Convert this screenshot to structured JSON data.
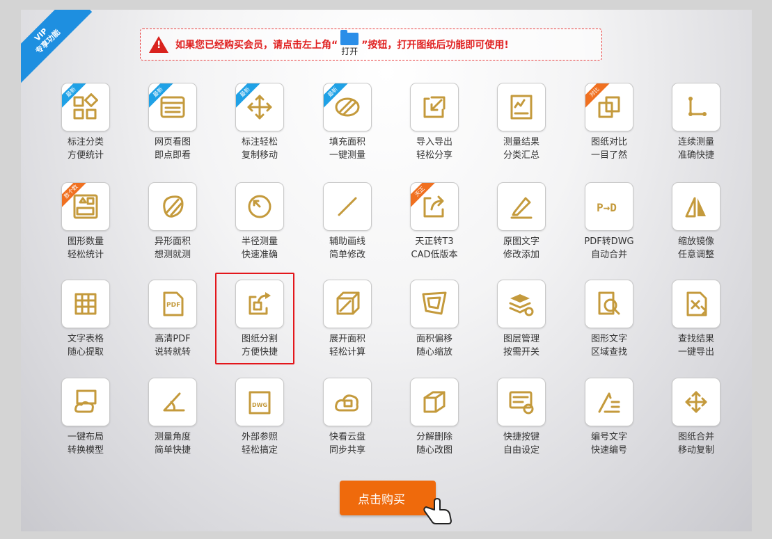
{
  "corner_ribbon": {
    "line1": "VIP",
    "line2": "专享功能"
  },
  "notice": {
    "before": "如果您已经购买会员，请点击左上角“",
    "open_label": "打开",
    "after": "”按钮，打开图纸后功能即可使用!"
  },
  "items": [
    {
      "line1": "标注分类",
      "line2": "方便统计",
      "icon": "grid-shapes-icon",
      "badge": "最新"
    },
    {
      "line1": "网页看图",
      "line2": "即点即看",
      "icon": "browser-window-icon",
      "badge": "最新"
    },
    {
      "line1": "标注轻松",
      "line2": "复制移动",
      "icon": "move-arrows-icon",
      "badge": "最新"
    },
    {
      "line1": "填充面积",
      "line2": "一键测量",
      "icon": "hatch-fill-icon",
      "badge": "最新"
    },
    {
      "line1": "导入导出",
      "line2": "轻松分享",
      "icon": "import-export-icon",
      "badge": ""
    },
    {
      "line1": "测量结果",
      "line2": "分类汇总",
      "icon": "measure-summary-icon",
      "badge": ""
    },
    {
      "line1": "图纸对比",
      "line2": "一目了然",
      "icon": "compare-squares-icon",
      "badge": "对比"
    },
    {
      "line1": "连续测量",
      "line2": "准确快捷",
      "icon": "continuous-measure-icon",
      "badge": ""
    },
    {
      "line1": "图形数量",
      "line2": "轻松统计",
      "icon": "shape-count-icon",
      "badge": "数个数"
    },
    {
      "line1": "异形面积",
      "line2": "想测就测",
      "icon": "irregular-area-icon",
      "badge": ""
    },
    {
      "line1": "半径测量",
      "line2": "快速准确",
      "icon": "radius-icon",
      "badge": ""
    },
    {
      "line1": "辅助画线",
      "line2": "简单修改",
      "icon": "line-icon",
      "badge": ""
    },
    {
      "line1": "天正转T3",
      "line2": "CAD低版本",
      "icon": "export-t3-icon",
      "badge": "天正"
    },
    {
      "line1": "原图文字",
      "line2": "修改添加",
      "icon": "pencil-icon",
      "badge": ""
    },
    {
      "line1": "PDF转DWG",
      "line2": "自动合并",
      "icon": "pdf-to-dwg-icon",
      "badge": ""
    },
    {
      "line1": "缩放镜像",
      "line2": "任意调整",
      "icon": "mirror-icon",
      "badge": ""
    },
    {
      "line1": "文字表格",
      "line2": "随心提取",
      "icon": "text-table-icon",
      "badge": ""
    },
    {
      "line1": "高清PDF",
      "line2": "说转就转",
      "icon": "pdf-export-icon",
      "badge": ""
    },
    {
      "line1": "图纸分割",
      "line2": "方便快捷",
      "icon": "split-drawing-icon",
      "badge": ""
    },
    {
      "line1": "展开面积",
      "line2": "轻松计算",
      "icon": "unfold-area-icon",
      "badge": ""
    },
    {
      "line1": "面积偏移",
      "line2": "随心缩放",
      "icon": "area-offset-icon",
      "badge": ""
    },
    {
      "line1": "图层管理",
      "line2": "按需开关",
      "icon": "layers-icon",
      "badge": ""
    },
    {
      "line1": "图形文字",
      "line2": "区域查找",
      "icon": "find-text-icon",
      "badge": ""
    },
    {
      "line1": "查找结果",
      "line2": "一键导出",
      "icon": "export-results-icon",
      "badge": ""
    },
    {
      "line1": "一键布局",
      "line2": "转换模型",
      "icon": "layout-cloud-icon",
      "badge": ""
    },
    {
      "line1": "测量角度",
      "line2": "简单快捷",
      "icon": "angle-icon",
      "badge": ""
    },
    {
      "line1": "外部参照",
      "line2": "轻松搞定",
      "icon": "xref-dwg-icon",
      "badge": ""
    },
    {
      "line1": "快看云盘",
      "line2": "同步共享",
      "icon": "cloud-share-icon",
      "badge": ""
    },
    {
      "line1": "分解删除",
      "line2": "随心改图",
      "icon": "explode-icon",
      "badge": ""
    },
    {
      "line1": "快捷按键",
      "line2": "自由设定",
      "icon": "keyboard-settings-icon",
      "badge": ""
    },
    {
      "line1": "编号文字",
      "line2": "快速编号",
      "icon": "numbering-icon",
      "badge": ""
    },
    {
      "line1": "图纸合并",
      "line2": "移动复制",
      "icon": "merge-arrows-icon",
      "badge": ""
    }
  ],
  "selected_index": 18,
  "buy_button": {
    "label": "点击购买"
  },
  "colors": {
    "icon": "#c49a3c",
    "accent_red": "#e3161b",
    "buy": "#ef6a0c",
    "ribbon": "#1e8fe0"
  }
}
